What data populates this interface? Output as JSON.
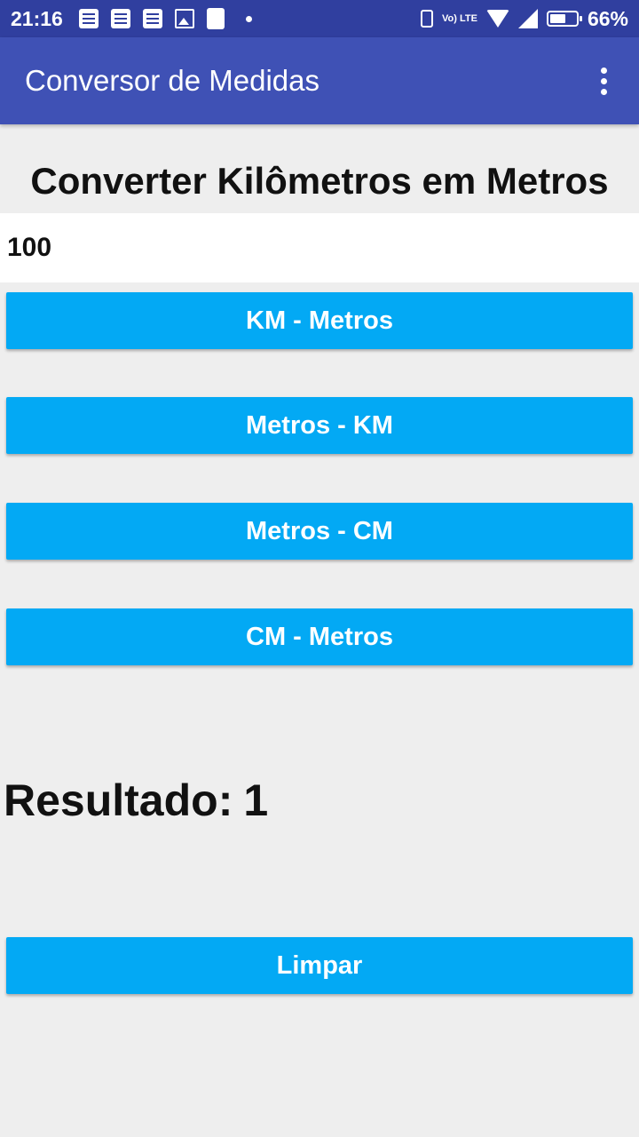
{
  "status_bar": {
    "time": "21:16",
    "battery_percent": "66%",
    "battery_level": 0.66,
    "lte_label": "Vo) LTE",
    "icons": [
      "document-icon",
      "document-icon",
      "document-icon",
      "image-icon",
      "puzzle-icon",
      "dot-icon",
      "vibrate-icon",
      "lte-icon",
      "wifi-icon",
      "signal-icon",
      "battery-icon"
    ]
  },
  "app_bar": {
    "title": "Conversor de Medidas",
    "menu_icon": "more-vert-icon"
  },
  "main": {
    "heading": "Converter Kilômetros em Metros",
    "input_value": "100",
    "buttons": {
      "km_to_m": "KM - Metros",
      "m_to_km": "Metros - KM",
      "m_to_cm": "Metros - CM",
      "cm_to_m": "CM - Metros"
    },
    "result_label": "Resultado:",
    "result_value": "1",
    "clear_button": "Limpar"
  },
  "colors": {
    "status_bar": "#303f9f",
    "app_bar": "#3f51b5",
    "button": "#03a9f4",
    "background": "#eeeeee"
  }
}
